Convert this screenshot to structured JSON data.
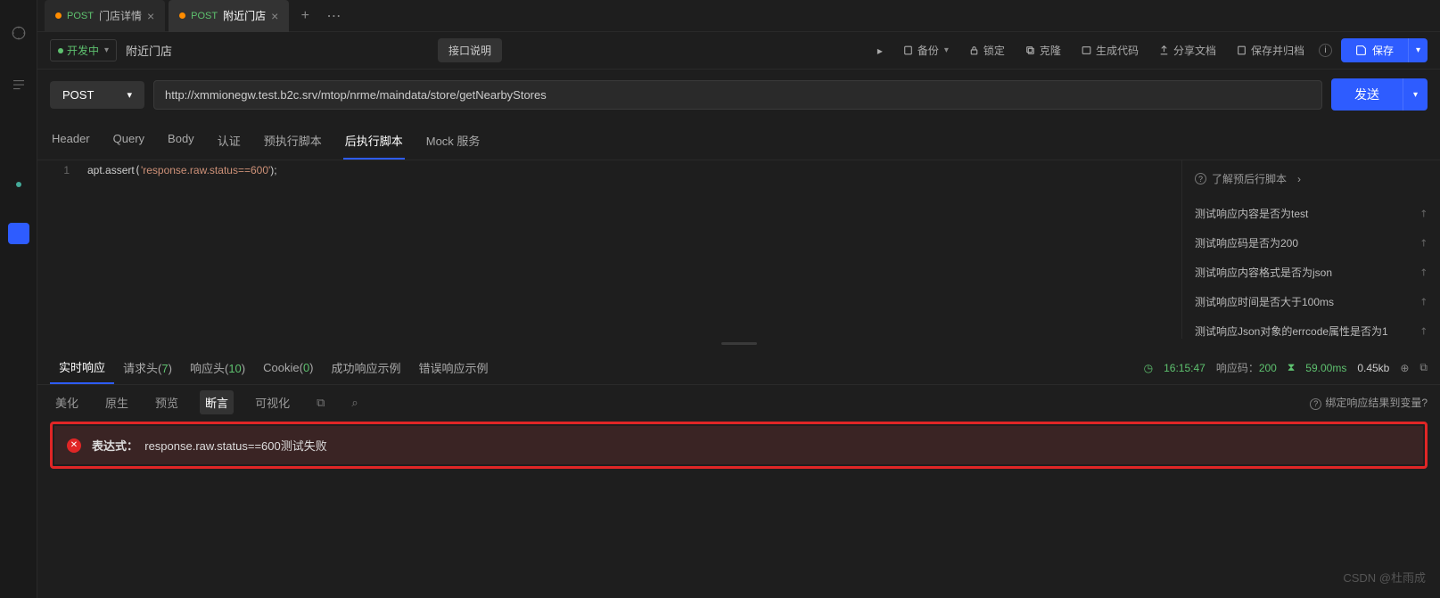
{
  "tabs": [
    {
      "method": "POST",
      "label": "门店详情"
    },
    {
      "method": "POST",
      "label": "附近门店"
    }
  ],
  "status_chip": "开发中",
  "api_name": "附近门店",
  "api_desc_btn": "接口说明",
  "toolbar": {
    "backup": "备份",
    "lock": "锁定",
    "clone": "克隆",
    "gencode": "生成代码",
    "sharedoc": "分享文档",
    "savearc": "保存并归档",
    "save": "保存"
  },
  "method": "POST",
  "url": "http://xmmionegw.test.b2c.srv/mtop/nrme/maindata/store/getNearbyStores",
  "send": "发送",
  "req_tabs": [
    "Header",
    "Query",
    "Body",
    "认证",
    "预执行脚本",
    "后执行脚本",
    "Mock 服务"
  ],
  "req_active": 5,
  "code": {
    "line1_no": "1",
    "fn": "apt.assert",
    "str": "'response.raw.status==600'",
    "tail": ");"
  },
  "snippets": {
    "head": "了解预后行脚本",
    "items": [
      "测试响应内容是否为test",
      "测试响应码是否为200",
      "测试响应内容格式是否为json",
      "测试响应时间是否大于100ms",
      "测试响应Json对象的errcode属性是否为1"
    ]
  },
  "resp_tabs": {
    "realtime": "实时响应",
    "reqhead": "请求头",
    "reqhead_n": "7",
    "resphead": "响应头",
    "resphead_n": "10",
    "cookie": "Cookie",
    "cookie_n": "0",
    "success_ex": "成功响应示例",
    "error_ex": "错误响应示例"
  },
  "resp_meta": {
    "time": "16:15:47",
    "code_label": "响应码：",
    "code": "200",
    "dur": "59.00ms",
    "size": "0.45kb"
  },
  "resp_sub": [
    "美化",
    "原生",
    "预览",
    "断言",
    "可视化"
  ],
  "resp_sub_active": 3,
  "bind_link": "绑定响应结果到变量?",
  "assertion": {
    "prefix": "表达式：",
    "text": "response.raw.status==600测试失败"
  },
  "watermark": "CSDN @杜雨成"
}
